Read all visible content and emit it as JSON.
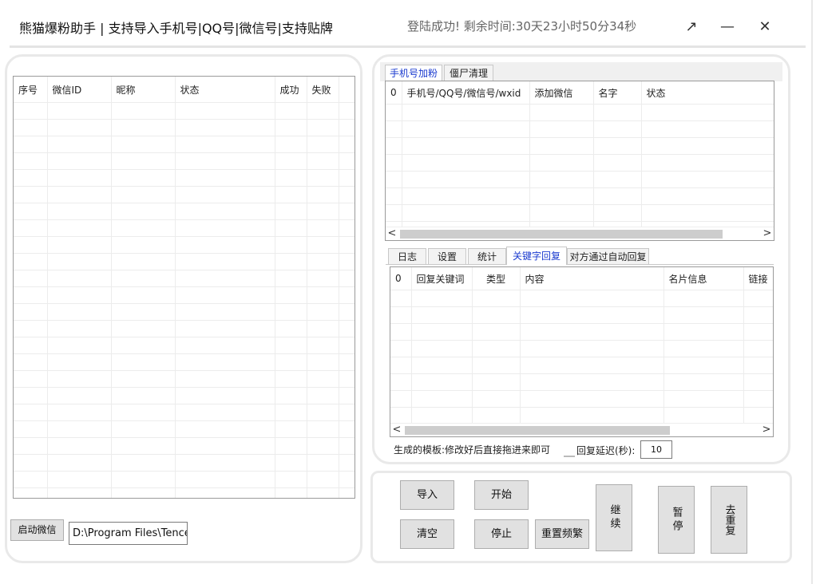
{
  "window": {
    "title": "熊猫爆粉助手 | 支持导入手机号|QQ号|微信号|支持贴牌",
    "status": "登陆成功!  剩余时间:30天23小时50分34秒",
    "controls": {
      "restore": "↗",
      "minimize": "—",
      "close": "✕"
    }
  },
  "left": {
    "columns": [
      "序号",
      "微信ID",
      "昵称",
      "状态",
      "成功",
      "失败"
    ],
    "launch_button": "启动微信",
    "path_value": "D:\\Program Files\\Tencent"
  },
  "right": {
    "top_tabs": [
      "手机号加粉",
      "僵尸清理"
    ],
    "top_columns": [
      "0",
      "手机号/QQ号/微信号/wxid",
      "添加微信",
      "名字",
      "状态"
    ],
    "bottom_tabs": [
      "日志",
      "设置",
      "统计",
      "关键字回复",
      "对方通过自动回复"
    ],
    "bottom_columns": [
      "0",
      "回复关键词",
      "类型",
      "内容",
      "名片信息",
      "链接"
    ],
    "template_hint": "生成的模板:修改好后直接拖进来即可",
    "delay_label": "回复延迟(秒):",
    "delay_value": "10"
  },
  "actions": {
    "import": "导入",
    "start": "开始",
    "clear": "清空",
    "stop": "停止",
    "reset_freq": "重置频繁",
    "continue": "继续",
    "pause": "暂停",
    "dedupe": "去重复"
  },
  "icons": {
    "left_arrow": "<",
    "right_arrow": ">"
  }
}
